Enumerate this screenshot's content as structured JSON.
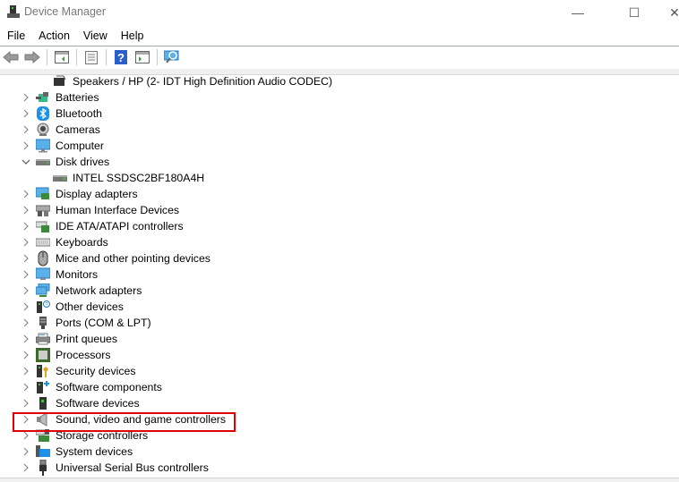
{
  "window": {
    "title": "Device Manager",
    "controls": {
      "minimize": "—",
      "maximize": "☐",
      "close": "✕"
    }
  },
  "menu": [
    "File",
    "Action",
    "View",
    "Help"
  ],
  "toolbar": [
    "back-icon",
    "forward-icon",
    "show-hide-console-tree-icon",
    "properties-icon",
    "help-icon",
    "action-pane-icon",
    "scan-hardware-icon"
  ],
  "tree": {
    "items": [
      {
        "label": "Speakers / HP (2- IDT High Definition Audio CODEC)",
        "icon": "speaker-device-icon",
        "level": 2,
        "expander": "none"
      },
      {
        "label": "Batteries",
        "icon": "battery-icon",
        "level": 1,
        "expander": "collapsed"
      },
      {
        "label": "Bluetooth",
        "icon": "bluetooth-icon",
        "level": 1,
        "expander": "collapsed"
      },
      {
        "label": "Cameras",
        "icon": "camera-icon",
        "level": 1,
        "expander": "collapsed"
      },
      {
        "label": "Computer",
        "icon": "computer-icon",
        "level": 1,
        "expander": "collapsed"
      },
      {
        "label": "Disk drives",
        "icon": "disk-drive-icon",
        "level": 1,
        "expander": "expanded"
      },
      {
        "label": "INTEL SSDSC2BF180A4H",
        "icon": "disk-drive-icon",
        "level": 2,
        "expander": "none"
      },
      {
        "label": "Display adapters",
        "icon": "display-adapter-icon",
        "level": 1,
        "expander": "collapsed"
      },
      {
        "label": "Human Interface Devices",
        "icon": "hid-icon",
        "level": 1,
        "expander": "collapsed"
      },
      {
        "label": "IDE ATA/ATAPI controllers",
        "icon": "ide-controller-icon",
        "level": 1,
        "expander": "collapsed"
      },
      {
        "label": "Keyboards",
        "icon": "keyboard-icon",
        "level": 1,
        "expander": "collapsed"
      },
      {
        "label": "Mice and other pointing devices",
        "icon": "mouse-icon",
        "level": 1,
        "expander": "collapsed"
      },
      {
        "label": "Monitors",
        "icon": "monitor-icon",
        "level": 1,
        "expander": "collapsed"
      },
      {
        "label": "Network adapters",
        "icon": "network-adapter-icon",
        "level": 1,
        "expander": "collapsed"
      },
      {
        "label": "Other devices",
        "icon": "other-devices-icon",
        "level": 1,
        "expander": "collapsed"
      },
      {
        "label": "Ports (COM & LPT)",
        "icon": "port-icon",
        "level": 1,
        "expander": "collapsed"
      },
      {
        "label": "Print queues",
        "icon": "printer-icon",
        "level": 1,
        "expander": "collapsed"
      },
      {
        "label": "Processors",
        "icon": "processor-icon",
        "level": 1,
        "expander": "collapsed"
      },
      {
        "label": "Security devices",
        "icon": "security-device-icon",
        "level": 1,
        "expander": "collapsed"
      },
      {
        "label": "Software components",
        "icon": "software-component-icon",
        "level": 1,
        "expander": "collapsed"
      },
      {
        "label": "Software devices",
        "icon": "software-device-icon",
        "level": 1,
        "expander": "collapsed"
      },
      {
        "label": "Sound, video and game controllers",
        "icon": "sound-controller-icon",
        "level": 1,
        "expander": "collapsed",
        "highlighted": true
      },
      {
        "label": "Storage controllers",
        "icon": "storage-controller-icon",
        "level": 1,
        "expander": "collapsed"
      },
      {
        "label": "System devices",
        "icon": "system-device-icon",
        "level": 1,
        "expander": "collapsed"
      },
      {
        "label": "Universal Serial Bus controllers",
        "icon": "usb-icon",
        "level": 1,
        "expander": "collapsed"
      }
    ]
  },
  "colors": {
    "highlight_border": "#e00000",
    "accent_blue": "#1e90e8"
  }
}
